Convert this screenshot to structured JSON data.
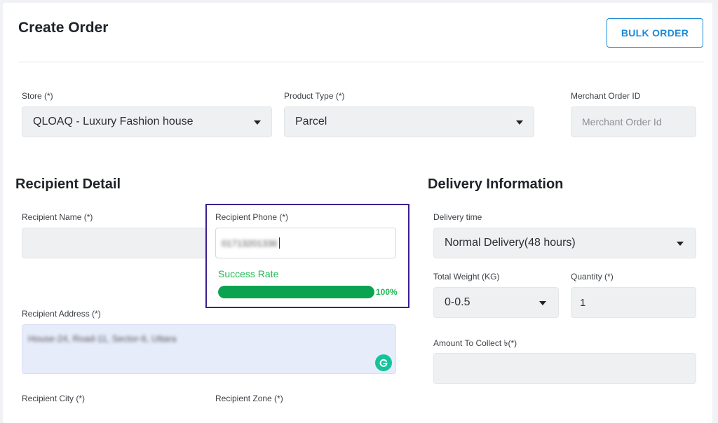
{
  "header": {
    "title": "Create Order",
    "bulk_order_label": "BULK ORDER"
  },
  "store": {
    "label": "Store (*)",
    "value": "QLOAQ - Luxury Fashion house"
  },
  "product_type": {
    "label": "Product Type (*)",
    "value": "Parcel"
  },
  "merchant_order": {
    "label": "Merchant Order ID",
    "placeholder": "Merchant Order Id"
  },
  "recipient": {
    "section_title": "Recipient Detail",
    "name_label": "Recipient Name (*)",
    "name_value": "",
    "phone_label": "Recipient Phone (*)",
    "phone_value": "01713201336",
    "success_rate_label": "Success Rate",
    "success_rate_percent": 100,
    "success_rate_text": "100%",
    "address_label": "Recipient Address (*)",
    "address_value": "House-24, Road-11, Sector-6, Uttara",
    "city_label": "Recipient City (*)",
    "zone_label": "Recipient Zone (*)"
  },
  "delivery": {
    "section_title": "Delivery Information",
    "time_label": "Delivery time",
    "time_value": "Normal Delivery(48 hours)",
    "weight_label": "Total Weight (KG)",
    "weight_value": "0-0.5",
    "quantity_label": "Quantity (*)",
    "quantity_value": "1",
    "amount_label": "Amount To Collect ৳(*)",
    "amount_value": ""
  },
  "colors": {
    "accent": "#1a8ad6",
    "success": "#0aa34f",
    "highlight_border": "#3b1f8f"
  },
  "icons": {
    "grammarly": "grammarly-icon",
    "caret": "caret-down-icon"
  }
}
